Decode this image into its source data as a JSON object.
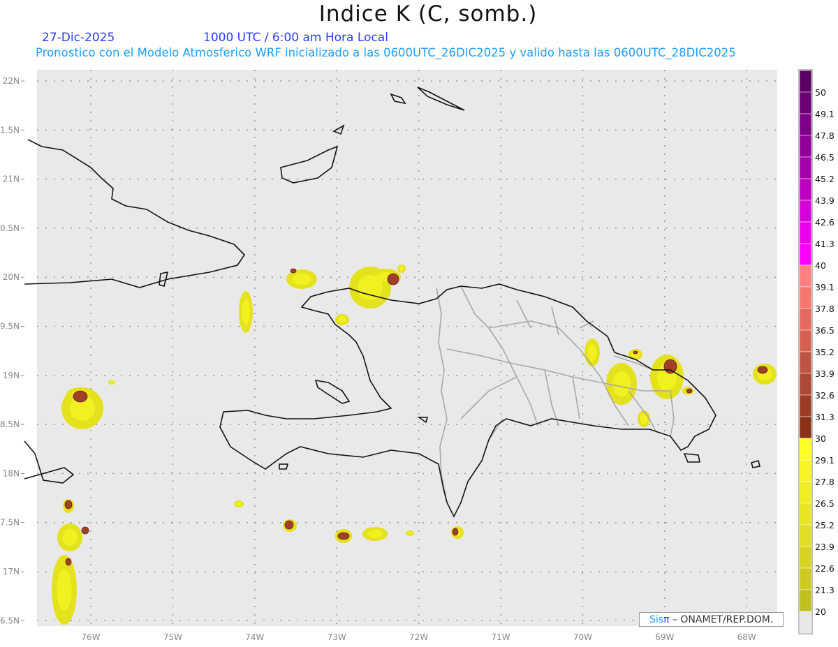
{
  "header": {
    "title": "Indice K (C, somb.)",
    "date": "27-Dic-2025",
    "time": "1000 UTC / 6:00 am Hora Local",
    "subtitle": "Pronostico con el Modelo Atmosferico WRF inicializado a las 0600UTC_26DIC2025 y valido hasta las  0600UTC_28DIC2025"
  },
  "map": {
    "background_color": "#e9e9e9",
    "lon_labels": [
      "76W",
      "75W",
      "74W",
      "73W",
      "72W",
      "71W",
      "70W",
      "69W",
      "68W"
    ],
    "lat_labels": [
      "22N",
      "1.5N",
      "21N",
      "0.5N",
      "20N",
      "9.5N",
      "19N",
      "8.5N",
      "18N",
      "7.5N",
      "17N",
      "6.5N"
    ]
  },
  "colorbar": {
    "labels": [
      "50",
      "49.1",
      "47.8",
      "46.5",
      "45.2",
      "43.9",
      "42.6",
      "41.3",
      "40",
      "39.1",
      "37.8",
      "36.5",
      "35.2",
      "33.9",
      "32.6",
      "31.3",
      "30",
      "29.1",
      "27.8",
      "26.5",
      "25.2",
      "23.9",
      "22.6",
      "21.3",
      "20"
    ],
    "colors": [
      "#5c0064",
      "#6a0074",
      "#7c0086",
      "#900098",
      "#a400aa",
      "#bb00c0",
      "#d600d8",
      "#ec00ec",
      "#ff00ff",
      "#ff8080",
      "#f47870",
      "#e46a60",
      "#d46050",
      "#c05444",
      "#ac4836",
      "#9a3c26",
      "#8a3216",
      "#ffff20",
      "#f8f520",
      "#f0ee20",
      "#e8e620",
      "#e0de20",
      "#d6d420",
      "#cccc20",
      "#c0c020",
      "#e8e8e8"
    ]
  },
  "logo": {
    "sis": "Sis",
    "pi": "π",
    "text": " –  ONAMET/REP.DOM."
  }
}
